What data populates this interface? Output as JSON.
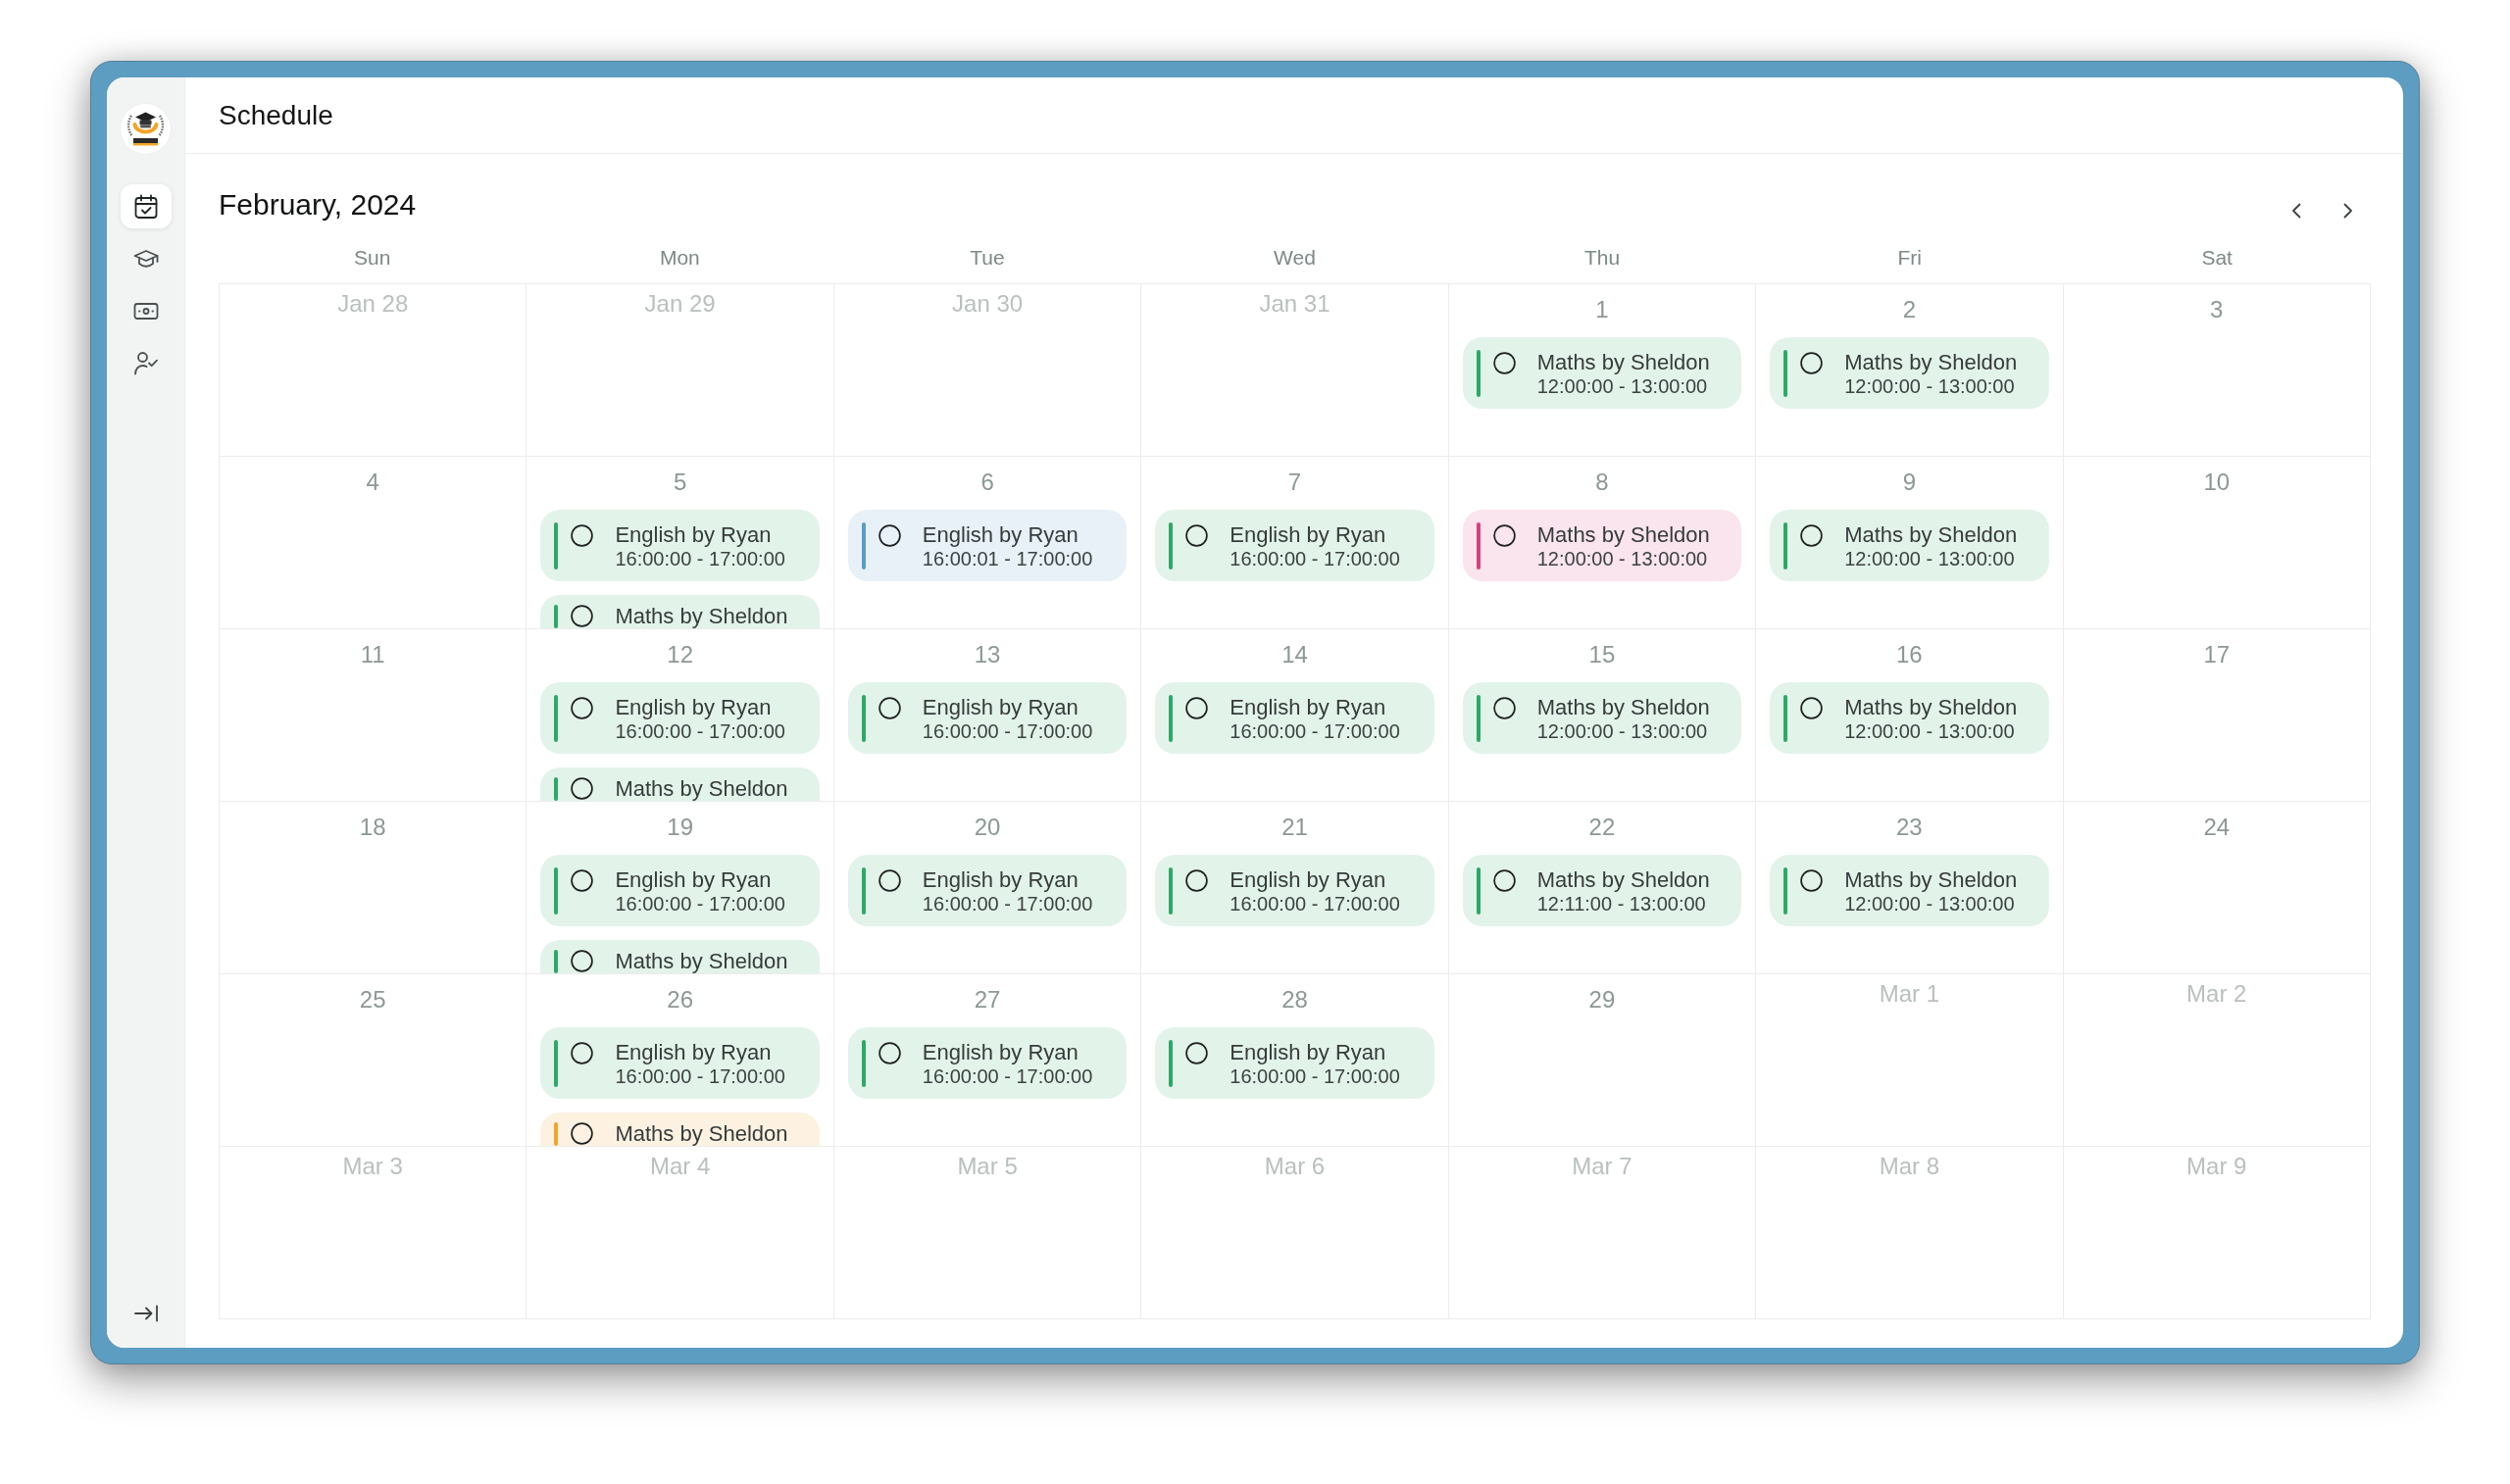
{
  "sidebar": {
    "items": [
      {
        "selected": true
      },
      {
        "selected": false
      },
      {
        "selected": false
      },
      {
        "selected": false
      }
    ]
  },
  "header": {
    "title": "Schedule"
  },
  "calendar": {
    "title": "February, 2024",
    "weekdays": [
      "Sun",
      "Mon",
      "Tue",
      "Wed",
      "Thu",
      "Fri",
      "Sat"
    ],
    "weeks": [
      {
        "days": [
          {
            "label": "Jan 28",
            "in_month": false
          },
          {
            "label": "Jan 29",
            "in_month": false
          },
          {
            "label": "Jan 30",
            "in_month": false
          },
          {
            "label": "Jan 31",
            "in_month": false
          },
          {
            "label": "1",
            "in_month": true,
            "events": [
              {
                "title": "Maths by Sheldon",
                "time": "12:00:00 - 13:00:00",
                "color": "#2ea866"
              }
            ]
          },
          {
            "label": "2",
            "in_month": true,
            "events": [
              {
                "title": "Maths by Sheldon",
                "time": "12:00:00 - 13:00:00",
                "color": "#2ea866"
              }
            ]
          },
          {
            "label": "3",
            "in_month": true
          }
        ]
      },
      {
        "days": [
          {
            "label": "4",
            "in_month": true
          },
          {
            "label": "5",
            "in_month": true,
            "events": [
              {
                "title": "English by Ryan",
                "time": "16:00:00 - 17:00:00",
                "color": "#2ea866"
              },
              {
                "title": "Maths by Sheldon",
                "color": "#2ea866"
              }
            ]
          },
          {
            "label": "6",
            "in_month": true,
            "events": [
              {
                "title": "English by Ryan",
                "time": "16:00:01 - 17:00:00",
                "color": "#5a9cc8"
              }
            ]
          },
          {
            "label": "7",
            "in_month": true,
            "events": [
              {
                "title": "English by Ryan",
                "time": "16:00:00 - 17:00:00",
                "color": "#2ea866"
              }
            ]
          },
          {
            "label": "8",
            "in_month": true,
            "events": [
              {
                "title": "Maths by Sheldon",
                "time": "12:00:00 - 13:00:00",
                "color": "#d8417f"
              }
            ]
          },
          {
            "label": "9",
            "in_month": true,
            "events": [
              {
                "title": "Maths by Sheldon",
                "time": "12:00:00 - 13:00:00",
                "color": "#2ea866"
              }
            ]
          },
          {
            "label": "10",
            "in_month": true
          }
        ]
      },
      {
        "days": [
          {
            "label": "11",
            "in_month": true
          },
          {
            "label": "12",
            "in_month": true,
            "events": [
              {
                "title": "English by Ryan",
                "time": "16:00:00 - 17:00:00",
                "color": "#2ea866"
              },
              {
                "title": "Maths by Sheldon",
                "color": "#2ea866"
              }
            ]
          },
          {
            "label": "13",
            "in_month": true,
            "events": [
              {
                "title": "English by Ryan",
                "time": "16:00:00 - 17:00:00",
                "color": "#2ea866"
              }
            ]
          },
          {
            "label": "14",
            "in_month": true,
            "events": [
              {
                "title": "English by Ryan",
                "time": "16:00:00 - 17:00:00",
                "color": "#2ea866"
              }
            ]
          },
          {
            "label": "15",
            "in_month": true,
            "events": [
              {
                "title": "Maths by Sheldon",
                "time": "12:00:00 - 13:00:00",
                "color": "#2ea866"
              }
            ]
          },
          {
            "label": "16",
            "in_month": true,
            "events": [
              {
                "title": "Maths by Sheldon",
                "time": "12:00:00 - 13:00:00",
                "color": "#2ea866"
              }
            ]
          },
          {
            "label": "17",
            "in_month": true
          }
        ]
      },
      {
        "days": [
          {
            "label": "18",
            "in_month": true
          },
          {
            "label": "19",
            "in_month": true,
            "events": [
              {
                "title": "English by Ryan",
                "time": "16:00:00 - 17:00:00",
                "color": "#2ea866"
              },
              {
                "title": "Maths by Sheldon",
                "color": "#2ea866"
              }
            ]
          },
          {
            "label": "20",
            "in_month": true,
            "events": [
              {
                "title": "English by Ryan",
                "time": "16:00:00 - 17:00:00",
                "color": "#2ea866"
              }
            ]
          },
          {
            "label": "21",
            "in_month": true,
            "events": [
              {
                "title": "English by Ryan",
                "time": "16:00:00 - 17:00:00",
                "color": "#2ea866"
              }
            ]
          },
          {
            "label": "22",
            "in_month": true,
            "events": [
              {
                "title": "Maths by Sheldon",
                "time": "12:11:00 - 13:00:00",
                "color": "#2ea866"
              }
            ]
          },
          {
            "label": "23",
            "in_month": true,
            "events": [
              {
                "title": "Maths by Sheldon",
                "time": "12:00:00 - 13:00:00",
                "color": "#2ea866"
              }
            ]
          },
          {
            "label": "24",
            "in_month": true
          }
        ]
      },
      {
        "days": [
          {
            "label": "25",
            "in_month": true
          },
          {
            "label": "26",
            "in_month": true,
            "events": [
              {
                "title": "English by Ryan",
                "time": "16:00:00 - 17:00:00",
                "color": "#2ea866"
              },
              {
                "title": "Maths by Sheldon",
                "color": "#f2a52a"
              }
            ]
          },
          {
            "label": "27",
            "in_month": true,
            "events": [
              {
                "title": "English by Ryan",
                "time": "16:00:00 - 17:00:00",
                "color": "#2ea866"
              }
            ]
          },
          {
            "label": "28",
            "in_month": true,
            "events": [
              {
                "title": "English by Ryan",
                "time": "16:00:00 - 17:00:00",
                "color": "#2ea866"
              }
            ]
          },
          {
            "label": "29",
            "in_month": true
          },
          {
            "label": "Mar 1",
            "in_month": false
          },
          {
            "label": "Mar 2",
            "in_month": false
          }
        ]
      },
      {
        "days": [
          {
            "label": "Mar 3",
            "in_month": false
          },
          {
            "label": "Mar 4",
            "in_month": false
          },
          {
            "label": "Mar 5",
            "in_month": false
          },
          {
            "label": "Mar 6",
            "in_month": false
          },
          {
            "label": "Mar 7",
            "in_month": false
          },
          {
            "label": "Mar 8",
            "in_month": false
          },
          {
            "label": "Mar 9",
            "in_month": false
          }
        ]
      }
    ]
  }
}
